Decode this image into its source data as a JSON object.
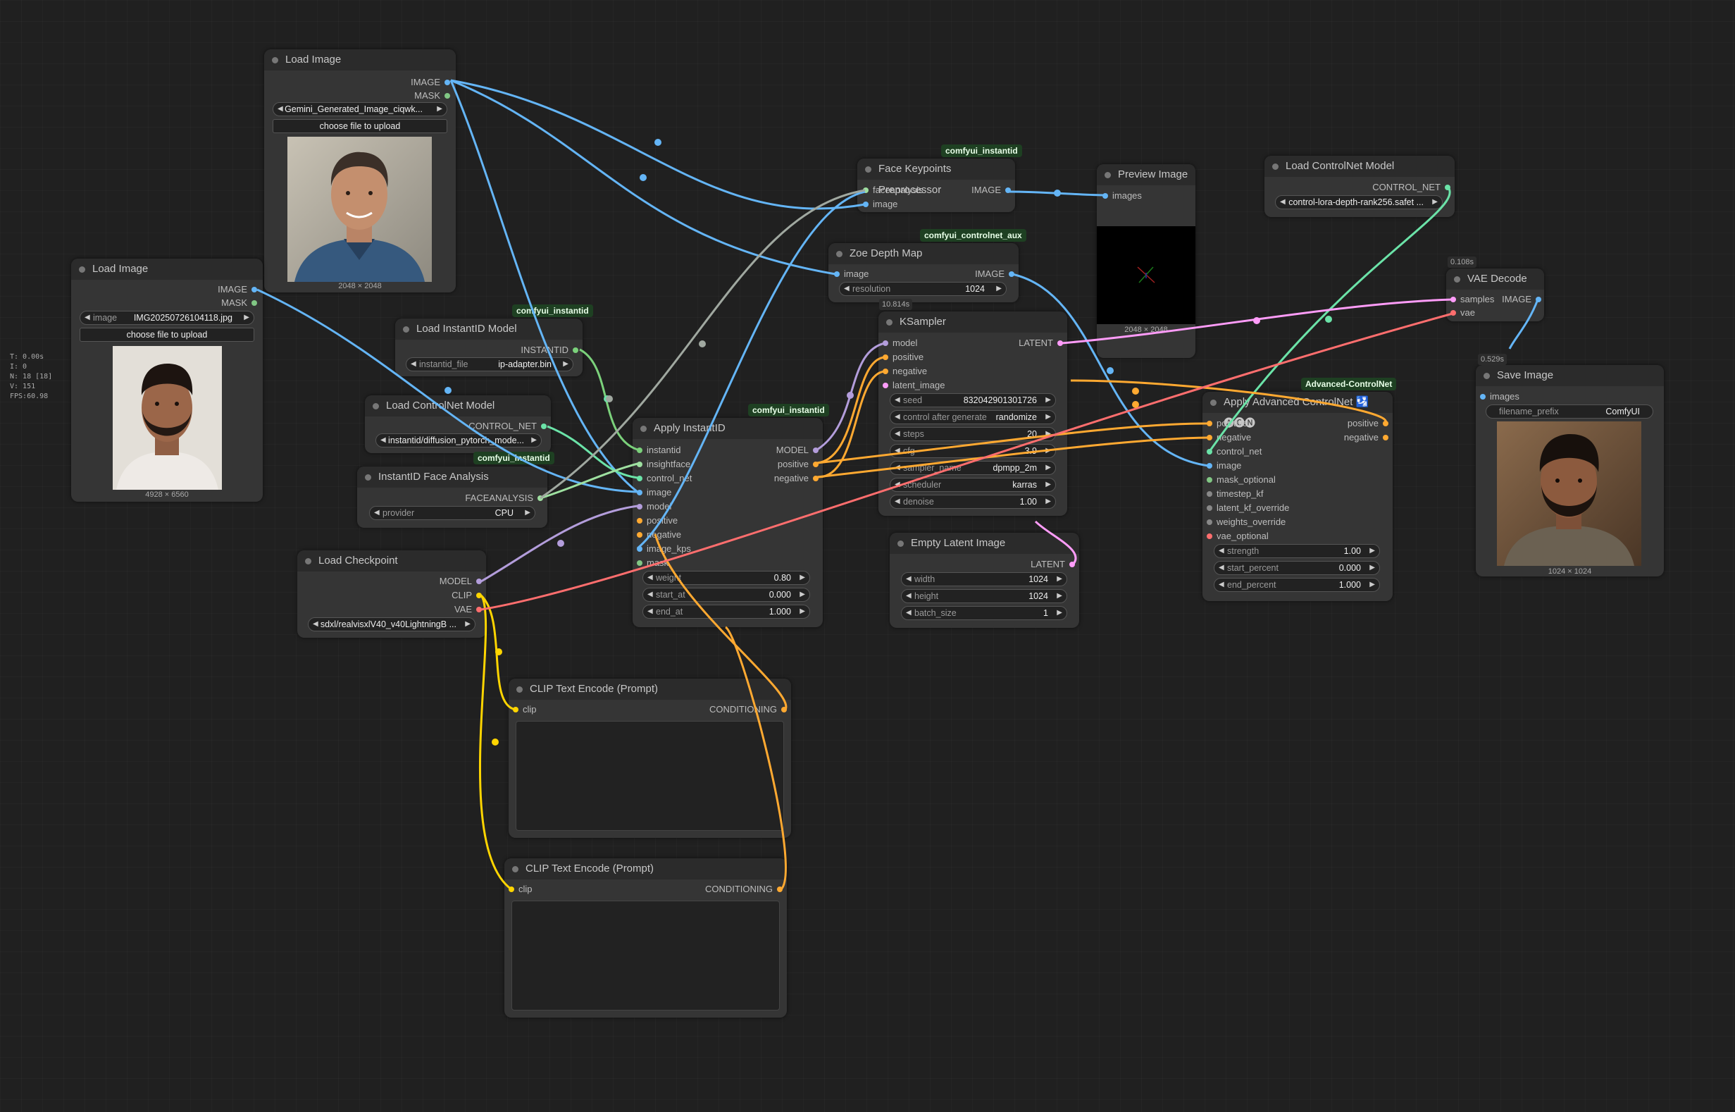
{
  "colors": {
    "image": "#64b5f6",
    "mask": "#81c784",
    "instantid": "#7bd17b",
    "control_net": "#6be3a8",
    "faceanalysis": "#9ee0a0",
    "model": "#b39ddb",
    "clip": "#ffd500",
    "conditioning": "#ffa931",
    "vae": "#ff6e6e",
    "latent": "#ff9cf9"
  },
  "stats": {
    "t": "T: 0.00s",
    "i": "I: 0",
    "n": "N: 18 [18]",
    "v": "V: 151",
    "fps": "FPS:60.98"
  },
  "load_image_1": {
    "title": "Load Image",
    "out_image": "IMAGE",
    "out_mask": "MASK",
    "file": "Gemini_Generated_Image_ciqwk...",
    "upload": "choose file to upload",
    "dims": "2048 × 2048"
  },
  "load_image_2": {
    "title": "Load Image",
    "out_image": "IMAGE",
    "out_mask": "MASK",
    "file_label": "image",
    "file": "IMG20250726104118.jpg",
    "upload": "choose file to upload",
    "dims": "4928 × 6560"
  },
  "load_instantid": {
    "badge": "comfyui_instantid",
    "title": "Load InstantID Model",
    "out": "INSTANTID",
    "w_label": "instantid_file",
    "w_value": "ip-adapter.bin"
  },
  "load_controlnet_1": {
    "title": "Load ControlNet Model",
    "out": "CONTROL_NET",
    "w_value": "instantid/diffusion_pytorch_mode..."
  },
  "face_analysis": {
    "badge": "comfyui_instantid",
    "title": "InstantID Face Analysis",
    "out": "FACEANALYSIS",
    "w_label": "provider",
    "w_value": "CPU"
  },
  "load_checkpoint": {
    "title": "Load Checkpoint",
    "out_model": "MODEL",
    "out_clip": "CLIP",
    "out_vae": "VAE",
    "w_value": "sdxl/realvisxlV40_v40LightningB ..."
  },
  "apply_instantid": {
    "badge": "comfyui_instantid",
    "title": "Apply InstantID",
    "inputs": [
      "instantid",
      "insightface",
      "control_net",
      "image",
      "model",
      "positive",
      "negative",
      "image_kps",
      "mask"
    ],
    "out_model": "MODEL",
    "out_positive": "positive",
    "out_negative": "negative",
    "widgets": [
      {
        "label": "weight",
        "value": "0.80"
      },
      {
        "label": "start_at",
        "value": "0.000"
      },
      {
        "label": "end_at",
        "value": "1.000"
      }
    ]
  },
  "face_keypoints": {
    "badge": "comfyui_instantid",
    "title": "Face Keypoints Preprocessor",
    "in_1": "faceanalysis",
    "in_2": "image",
    "out": "IMAGE"
  },
  "zoe_depth": {
    "badge": "comfyui_controlnet_aux",
    "title": "Zoe Depth Map",
    "in": "image",
    "out": "IMAGE",
    "w_label": "resolution",
    "w_value": "1024"
  },
  "preview": {
    "title": "Preview Image",
    "in": "images",
    "dims": "2048 × 2048"
  },
  "ksampler": {
    "timing": "10.814s",
    "title": "KSampler",
    "inputs": [
      "model",
      "positive",
      "negative",
      "latent_image"
    ],
    "out": "LATENT",
    "widgets": [
      {
        "label": "seed",
        "value": "832042901301726"
      },
      {
        "label": "control after generate",
        "value": "randomize"
      },
      {
        "label": "steps",
        "value": "20"
      },
      {
        "label": "cfg",
        "value": "3.9"
      },
      {
        "label": "sampler_name",
        "value": "dpmpp_2m"
      },
      {
        "label": "scheduler",
        "value": "karras"
      },
      {
        "label": "denoise",
        "value": "1.00"
      }
    ]
  },
  "empty_latent": {
    "title": "Empty Latent Image",
    "out": "LATENT",
    "widgets": [
      {
        "label": "width",
        "value": "1024"
      },
      {
        "label": "height",
        "value": "1024"
      },
      {
        "label": "batch_size",
        "value": "1"
      }
    ]
  },
  "load_controlnet_2": {
    "title": "Load ControlNet Model",
    "out": "CONTROL_NET",
    "w_value": "control-lora-depth-rank256.safet ..."
  },
  "apply_advanced": {
    "badge": "Advanced-ControlNet",
    "title": "Apply Advanced ControlNet 🛂🅐🅒🅝",
    "inputs": [
      "positive",
      "negative",
      "control_net",
      "image",
      "mask_optional",
      "timestep_kf",
      "latent_kf_override",
      "weights_override",
      "vae_optional"
    ],
    "out_positive": "positive",
    "out_negative": "negative",
    "widgets": [
      {
        "label": "strength",
        "value": "1.00"
      },
      {
        "label": "start_percent",
        "value": "0.000"
      },
      {
        "label": "end_percent",
        "value": "1.000"
      }
    ]
  },
  "vae_decode": {
    "timing": "0.108s",
    "title": "VAE Decode",
    "in_samples": "samples",
    "in_vae": "vae",
    "out": "IMAGE"
  },
  "save_image": {
    "timing": "0.529s",
    "title": "Save Image",
    "in": "images",
    "w_label": "filename_prefix",
    "w_value": "ComfyUI",
    "dims": "1024 × 1024"
  },
  "clip_1": {
    "title": "CLIP Text Encode (Prompt)",
    "in": "clip",
    "out": "CONDITIONING"
  },
  "clip_2": {
    "title": "CLIP Text Encode (Prompt)",
    "in": "clip",
    "out": "CONDITIONING"
  }
}
